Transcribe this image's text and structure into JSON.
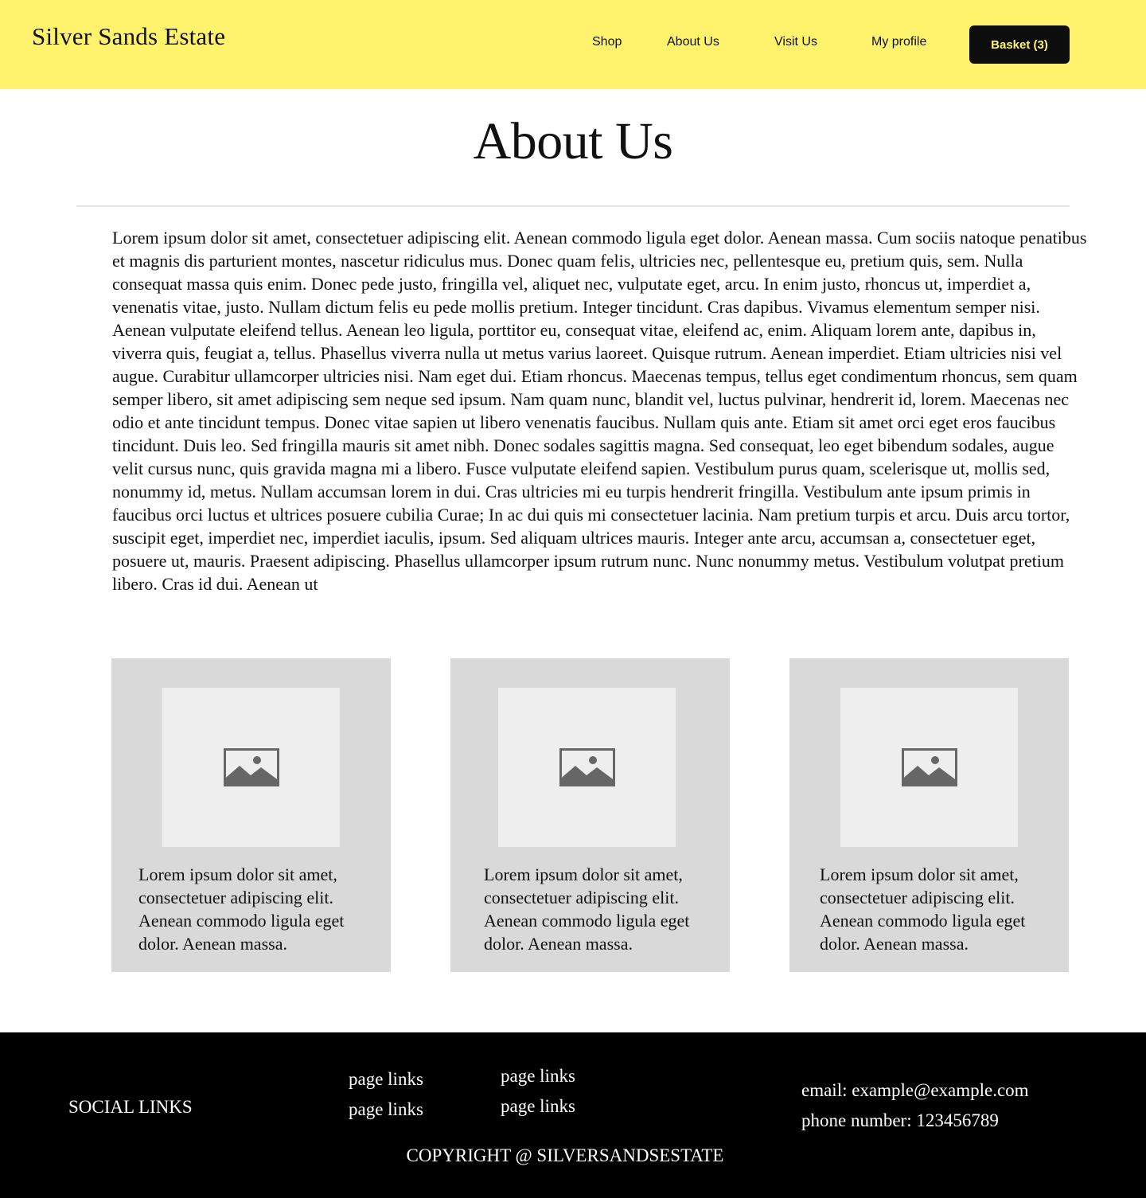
{
  "header": {
    "brand": "Silver Sands Estate",
    "nav": {
      "shop": "Shop",
      "about": "About Us",
      "visit": "Visit Us",
      "profile": "My profile"
    },
    "basket_label": "Basket (3)",
    "background_color": "#fff36e"
  },
  "main": {
    "title": "About Us",
    "intro": "Lorem ipsum dolor sit amet, consectetuer adipiscing elit. Aenean commodo ligula eget dolor. Aenean massa. Cum sociis natoque penatibus et magnis dis parturient montes, nascetur ridiculus mus. Donec quam felis, ultricies nec, pellentesque eu, pretium quis, sem. Nulla consequat massa quis enim. Donec pede justo, fringilla vel, aliquet nec, vulputate eget, arcu. In enim justo, rhoncus ut, imperdiet a, venenatis vitae, justo. Nullam dictum felis eu pede mollis pretium. Integer tincidunt. Cras dapibus. Vivamus elementum semper nisi. Aenean vulputate eleifend tellus. Aenean leo ligula, porttitor eu, consequat vitae, eleifend ac, enim. Aliquam lorem ante, dapibus in, viverra quis, feugiat a, tellus. Phasellus viverra nulla ut metus varius laoreet. Quisque rutrum. Aenean imperdiet. Etiam ultricies nisi vel augue. Curabitur ullamcorper ultricies nisi. Nam eget dui. Etiam rhoncus. Maecenas tempus, tellus eget condimentum rhoncus, sem quam semper libero, sit amet adipiscing sem neque sed ipsum. Nam quam nunc, blandit vel, luctus pulvinar, hendrerit id, lorem. Maecenas nec odio et ante tincidunt tempus. Donec vitae sapien ut libero venenatis faucibus. Nullam quis ante. Etiam sit amet orci eget eros faucibus tincidunt. Duis leo. Sed fringilla mauris sit amet nibh. Donec sodales sagittis magna. Sed consequat, leo eget bibendum sodales, augue velit cursus nunc, quis gravida magna mi a libero. Fusce vulputate eleifend sapien. Vestibulum purus quam, scelerisque ut, mollis sed, nonummy id, metus. Nullam accumsan lorem in dui. Cras ultricies mi eu turpis hendrerit fringilla. Vestibulum ante ipsum primis in faucibus orci luctus et ultrices posuere cubilia Curae; In ac dui quis mi consectetuer lacinia. Nam pretium turpis et arcu. Duis arcu tortor, suscipit eget, imperdiet nec, imperdiet iaculis, ipsum. Sed aliquam ultrices mauris. Integer ante arcu, accumsan a, consectetuer eget, posuere ut, mauris. Praesent adipiscing. Phasellus ullamcorper ipsum rutrum nunc. Nunc nonummy metus. Vestibulum volutpat pretium libero. Cras id dui. Aenean ut",
    "cards": [
      {
        "icon": "image-placeholder-icon",
        "text": "Lorem ipsum dolor sit amet, consectetuer adipiscing elit. Aenean commodo ligula eget dolor. Aenean massa."
      },
      {
        "icon": "image-placeholder-icon",
        "text": "Lorem ipsum dolor sit amet, consectetuer adipiscing elit. Aenean commodo ligula eget dolor. Aenean massa."
      },
      {
        "icon": "image-placeholder-icon",
        "text": "Lorem ipsum dolor sit amet, consectetuer adipiscing elit. Aenean commodo ligula eget dolor. Aenean massa."
      }
    ]
  },
  "footer": {
    "social": "SOCIAL LINKS",
    "page_links": [
      "page links",
      "page links",
      "page links",
      "page links"
    ],
    "email": "email: example@example.com",
    "phone": "phone number: 123456789",
    "copyright": "COPYRIGHT @ SILVERSANDSESTATE"
  }
}
